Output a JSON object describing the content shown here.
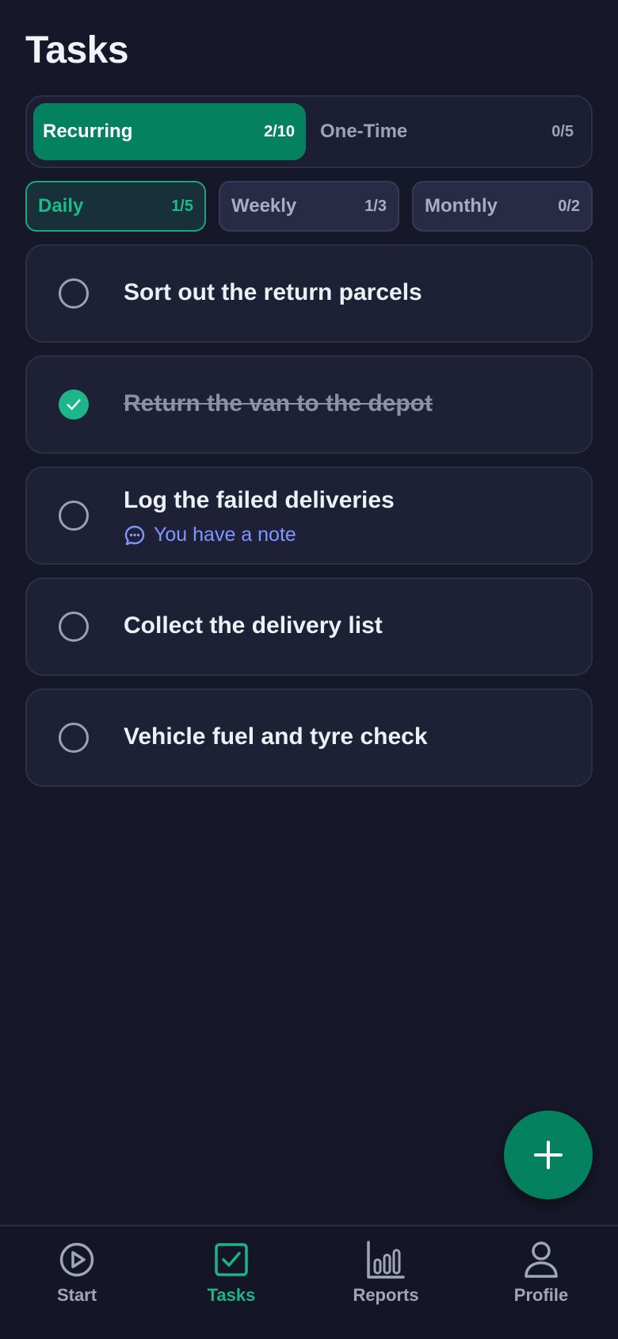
{
  "page": {
    "title": "Tasks"
  },
  "segments": [
    {
      "label": "Recurring",
      "count": "2/10",
      "active": true
    },
    {
      "label": "One-Time",
      "count": "0/5",
      "active": false
    }
  ],
  "filters": [
    {
      "label": "Daily",
      "count": "1/5",
      "active": true
    },
    {
      "label": "Weekly",
      "count": "1/3",
      "active": false
    },
    {
      "label": "Monthly",
      "count": "0/2",
      "active": false
    }
  ],
  "tasks": [
    {
      "title": "Sort out the return parcels",
      "done": false
    },
    {
      "title": "Return the van to the depot",
      "done": true
    },
    {
      "title": "Log the failed deliveries",
      "done": false,
      "note": "You have a note"
    },
    {
      "title": "Collect the delivery list",
      "done": false
    },
    {
      "title": "Vehicle fuel and tyre check",
      "done": false
    }
  ],
  "fab": {
    "icon": "plus-icon"
  },
  "nav": [
    {
      "label": "Start",
      "icon": "play-circle-icon",
      "active": false
    },
    {
      "label": "Tasks",
      "icon": "check-square-icon",
      "active": true
    },
    {
      "label": "Reports",
      "icon": "bar-chart-icon",
      "active": false
    },
    {
      "label": "Profile",
      "icon": "user-icon",
      "active": false
    }
  ],
  "colors": {
    "background": "#161829",
    "accent": "#04825f",
    "accent_text": "#1cb487",
    "note": "#7e96ff"
  }
}
